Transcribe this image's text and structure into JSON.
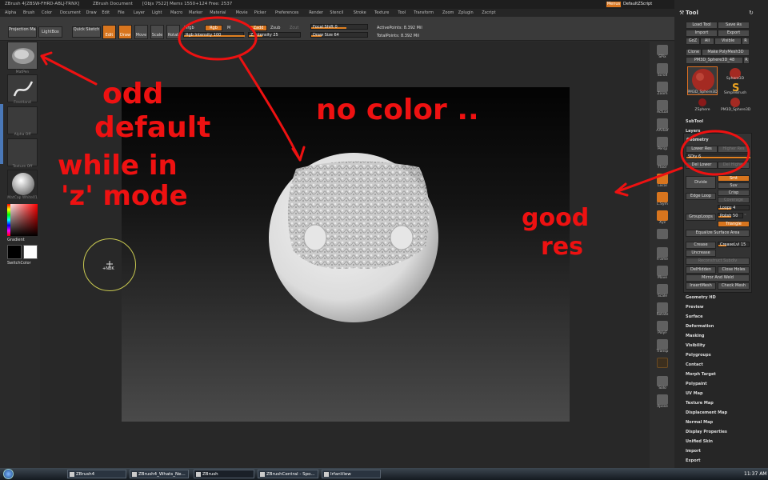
{
  "title": {
    "app": "ZBrush 4[ZBSW-FHRD-ABLJ-TRNX]",
    "doc": "ZBrush Document",
    "info": "[Objs 7522] Mems 1550+124 Free: 2537"
  },
  "menu": [
    "Alpha",
    "Brush",
    "Color",
    "Document",
    "Draw",
    "Edit",
    "File",
    "Layer",
    "Light",
    "Macro",
    "Marker",
    "Material",
    "Movie",
    "Picker",
    "Preferences",
    "Render",
    "Stencil",
    "Stroke",
    "Texture",
    "Tool",
    "Transform",
    "Zoom",
    "Zplugin",
    "Zscript"
  ],
  "top_right": {
    "menus": "Menus",
    "script": "DefaultZScript"
  },
  "shelf": {
    "projection_master": "Projection Master",
    "lightbox": "LightBox",
    "quick_sketch": "Quick Sketch",
    "edit": "Edit",
    "draw": "Draw",
    "move": "Move",
    "scale": "Scale",
    "rotate": "Rotat",
    "mrgb": "Mrgb",
    "rgb": "Rgb",
    "m": "M",
    "zadd": "Zadd",
    "zsub": "Zsub",
    "zcut": "Zcut",
    "rgb_intensity": "Rgb Intensity 100",
    "z_intensity": "Z Intensity 25",
    "focal_shift": "Focal Shift 0",
    "draw_size": "Draw Size 64",
    "active_points": "ActivePoints: 8.392 Mil",
    "total_points": "TotalPoints: 8.392 Mil",
    "rgb_intensity_level": 1.0,
    "z_intensity_level": 0.25,
    "draw_size_level": 0.18
  },
  "left": {
    "brush": "MatPen",
    "stroke": "FreeHand",
    "alpha": "Alpha Off",
    "texture": "Texture Off",
    "material": "MatCap White01",
    "gradient": "Gradient",
    "switch_color": "SwitchColor"
  },
  "right_tools": [
    "SPix",
    "Scroll",
    "Zoom",
    "Actual",
    "AAHalf",
    "Persp",
    "Floor",
    "Local",
    "L.Sym",
    "Xyz",
    "",
    "Frame",
    "Move",
    "Scale",
    "Rotate",
    "PolyF",
    "Transp",
    "",
    "Solo",
    "Xpose"
  ],
  "cursor": "+NBK",
  "tool": {
    "header": "Tool",
    "load": "Load Tool",
    "save_as": "Save As",
    "import": "Import",
    "export": "Export",
    "goz": "GoZ",
    "all": "All",
    "visible": "Visible",
    "r": "R",
    "clone": "Clone",
    "make_polymesh": "Make PolyMesh3D",
    "current_tool": "PM3D_Sphere3D_48",
    "thumbs": [
      "PM3D_Sphere3D",
      "Sphere3D",
      "SimpleBrush",
      "ZSphere",
      "PM3D_Sphere3D"
    ],
    "subtool": "SubTool",
    "layers": "Layers",
    "geometry": "Geometry",
    "lower_res": "Lower Res",
    "higher_res": "Higher Res",
    "sdiv": "SDiv 6",
    "del_lower": "Del Lower",
    "del_higher": "Del Higher",
    "divide": "Divide",
    "smt": "Smt",
    "suv": "Suv",
    "edge_loop": "Edge Loop",
    "crisp": "Crisp",
    "coverage": "Coverage",
    "loops": "Loops 4",
    "grouploops": "GroupLoops",
    "polish": "Polish 50",
    "triangle": "Triangle",
    "equalize": "Equalize Surface Area",
    "crease": "Crease",
    "creaselvl": "CreaseLvl 15",
    "uncrease": "Uncrease",
    "reconstruct": "Reconstruct Subdiv",
    "delhidden": "DelHidden",
    "close_holes": "Close Holes",
    "mirror_weld": "Mirror And Weld",
    "insertmesh": "InsertMesh",
    "check_mesh": "Check Mesh",
    "sections": [
      "Geometry HD",
      "Preview",
      "Surface",
      "Deformation",
      "Masking",
      "Visibility",
      "Polygroups",
      "Contact",
      "Morph Target",
      "Polypaint",
      "UV Map",
      "Texture Map",
      "Displacement Map",
      "Normal Map",
      "Display Properties",
      "Unified Skin",
      "Import",
      "Export"
    ]
  },
  "taskbar": [
    "ZBrush4",
    "ZBrush4_Whats_Ne...",
    "ZBrush",
    "ZBrushCentral - Spo...",
    "IrfanView"
  ],
  "clock": "11:37 AM",
  "annotations": {
    "odd_1": "odd",
    "odd_2": "default",
    "odd_3": "while in",
    "odd_4": "'z' mode",
    "no_color": "no color ..",
    "good_1": "good",
    "good_2": "res"
  }
}
